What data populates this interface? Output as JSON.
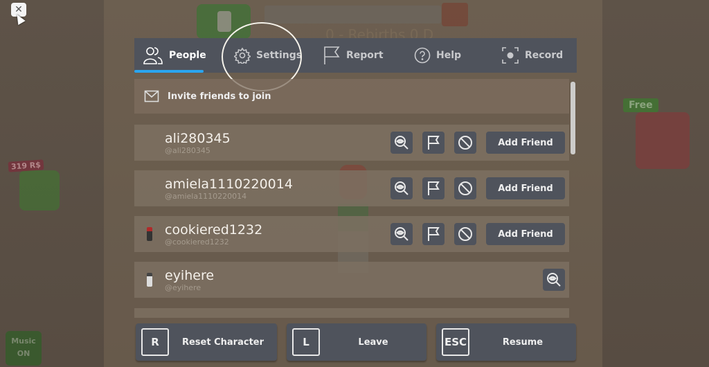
{
  "background": {
    "top_text": "0 - Rebirths 0 D",
    "side_price": "319 R$",
    "right_badge": "Free",
    "music_button": {
      "line1": "Music",
      "line2": "ON"
    }
  },
  "close_button": {
    "label": "✕"
  },
  "tabs": [
    {
      "label": "People",
      "icon": "people-icon",
      "active": true
    },
    {
      "label": "Settings",
      "icon": "gear-icon",
      "active": false
    },
    {
      "label": "Report",
      "icon": "flag-icon",
      "active": false
    },
    {
      "label": "Help",
      "icon": "help-icon",
      "active": false
    },
    {
      "label": "Record",
      "icon": "record-icon",
      "active": false
    }
  ],
  "colors": {
    "accent": "#2aa5ef",
    "panel": "#4f535c",
    "row": "#7d7062"
  },
  "invite": {
    "label": "Invite friends to join"
  },
  "players": [
    {
      "display_name": "ali280345",
      "username": "@ali280345",
      "add_friend": "Add Friend",
      "self": false
    },
    {
      "display_name": "amiela1110220014",
      "username": "@amiela1110220014",
      "add_friend": "Add Friend",
      "self": false
    },
    {
      "display_name": "cookiered1232",
      "username": "@cookiered1232",
      "add_friend": "Add Friend",
      "self": false
    },
    {
      "display_name": "eyihere",
      "username": "@eyihere",
      "self": true
    }
  ],
  "bottom": [
    {
      "key": "R",
      "label": "Reset Character"
    },
    {
      "key": "L",
      "label": "Leave"
    },
    {
      "key": "ESC",
      "label": "Resume"
    }
  ]
}
